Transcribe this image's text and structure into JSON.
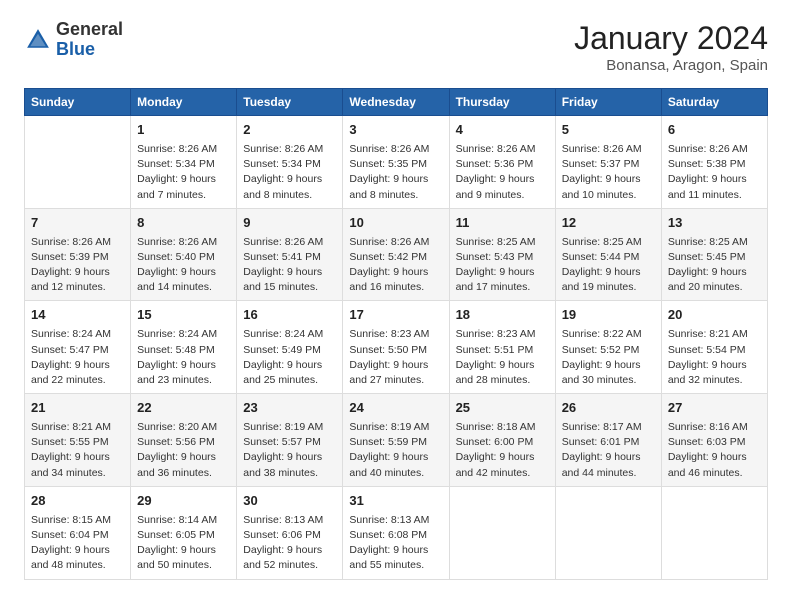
{
  "header": {
    "logo_general": "General",
    "logo_blue": "Blue",
    "month_title": "January 2024",
    "location": "Bonansa, Aragon, Spain"
  },
  "weekdays": [
    "Sunday",
    "Monday",
    "Tuesday",
    "Wednesday",
    "Thursday",
    "Friday",
    "Saturday"
  ],
  "weeks": [
    [
      {
        "day": "",
        "content": ""
      },
      {
        "day": "1",
        "content": "Sunrise: 8:26 AM\nSunset: 5:34 PM\nDaylight: 9 hours\nand 7 minutes."
      },
      {
        "day": "2",
        "content": "Sunrise: 8:26 AM\nSunset: 5:34 PM\nDaylight: 9 hours\nand 8 minutes."
      },
      {
        "day": "3",
        "content": "Sunrise: 8:26 AM\nSunset: 5:35 PM\nDaylight: 9 hours\nand 8 minutes."
      },
      {
        "day": "4",
        "content": "Sunrise: 8:26 AM\nSunset: 5:36 PM\nDaylight: 9 hours\nand 9 minutes."
      },
      {
        "day": "5",
        "content": "Sunrise: 8:26 AM\nSunset: 5:37 PM\nDaylight: 9 hours\nand 10 minutes."
      },
      {
        "day": "6",
        "content": "Sunrise: 8:26 AM\nSunset: 5:38 PM\nDaylight: 9 hours\nand 11 minutes."
      }
    ],
    [
      {
        "day": "7",
        "content": "Sunrise: 8:26 AM\nSunset: 5:39 PM\nDaylight: 9 hours\nand 12 minutes."
      },
      {
        "day": "8",
        "content": "Sunrise: 8:26 AM\nSunset: 5:40 PM\nDaylight: 9 hours\nand 14 minutes."
      },
      {
        "day": "9",
        "content": "Sunrise: 8:26 AM\nSunset: 5:41 PM\nDaylight: 9 hours\nand 15 minutes."
      },
      {
        "day": "10",
        "content": "Sunrise: 8:26 AM\nSunset: 5:42 PM\nDaylight: 9 hours\nand 16 minutes."
      },
      {
        "day": "11",
        "content": "Sunrise: 8:25 AM\nSunset: 5:43 PM\nDaylight: 9 hours\nand 17 minutes."
      },
      {
        "day": "12",
        "content": "Sunrise: 8:25 AM\nSunset: 5:44 PM\nDaylight: 9 hours\nand 19 minutes."
      },
      {
        "day": "13",
        "content": "Sunrise: 8:25 AM\nSunset: 5:45 PM\nDaylight: 9 hours\nand 20 minutes."
      }
    ],
    [
      {
        "day": "14",
        "content": "Sunrise: 8:24 AM\nSunset: 5:47 PM\nDaylight: 9 hours\nand 22 minutes."
      },
      {
        "day": "15",
        "content": "Sunrise: 8:24 AM\nSunset: 5:48 PM\nDaylight: 9 hours\nand 23 minutes."
      },
      {
        "day": "16",
        "content": "Sunrise: 8:24 AM\nSunset: 5:49 PM\nDaylight: 9 hours\nand 25 minutes."
      },
      {
        "day": "17",
        "content": "Sunrise: 8:23 AM\nSunset: 5:50 PM\nDaylight: 9 hours\nand 27 minutes."
      },
      {
        "day": "18",
        "content": "Sunrise: 8:23 AM\nSunset: 5:51 PM\nDaylight: 9 hours\nand 28 minutes."
      },
      {
        "day": "19",
        "content": "Sunrise: 8:22 AM\nSunset: 5:52 PM\nDaylight: 9 hours\nand 30 minutes."
      },
      {
        "day": "20",
        "content": "Sunrise: 8:21 AM\nSunset: 5:54 PM\nDaylight: 9 hours\nand 32 minutes."
      }
    ],
    [
      {
        "day": "21",
        "content": "Sunrise: 8:21 AM\nSunset: 5:55 PM\nDaylight: 9 hours\nand 34 minutes."
      },
      {
        "day": "22",
        "content": "Sunrise: 8:20 AM\nSunset: 5:56 PM\nDaylight: 9 hours\nand 36 minutes."
      },
      {
        "day": "23",
        "content": "Sunrise: 8:19 AM\nSunset: 5:57 PM\nDaylight: 9 hours\nand 38 minutes."
      },
      {
        "day": "24",
        "content": "Sunrise: 8:19 AM\nSunset: 5:59 PM\nDaylight: 9 hours\nand 40 minutes."
      },
      {
        "day": "25",
        "content": "Sunrise: 8:18 AM\nSunset: 6:00 PM\nDaylight: 9 hours\nand 42 minutes."
      },
      {
        "day": "26",
        "content": "Sunrise: 8:17 AM\nSunset: 6:01 PM\nDaylight: 9 hours\nand 44 minutes."
      },
      {
        "day": "27",
        "content": "Sunrise: 8:16 AM\nSunset: 6:03 PM\nDaylight: 9 hours\nand 46 minutes."
      }
    ],
    [
      {
        "day": "28",
        "content": "Sunrise: 8:15 AM\nSunset: 6:04 PM\nDaylight: 9 hours\nand 48 minutes."
      },
      {
        "day": "29",
        "content": "Sunrise: 8:14 AM\nSunset: 6:05 PM\nDaylight: 9 hours\nand 50 minutes."
      },
      {
        "day": "30",
        "content": "Sunrise: 8:13 AM\nSunset: 6:06 PM\nDaylight: 9 hours\nand 52 minutes."
      },
      {
        "day": "31",
        "content": "Sunrise: 8:13 AM\nSunset: 6:08 PM\nDaylight: 9 hours\nand 55 minutes."
      },
      {
        "day": "",
        "content": ""
      },
      {
        "day": "",
        "content": ""
      },
      {
        "day": "",
        "content": ""
      }
    ]
  ]
}
